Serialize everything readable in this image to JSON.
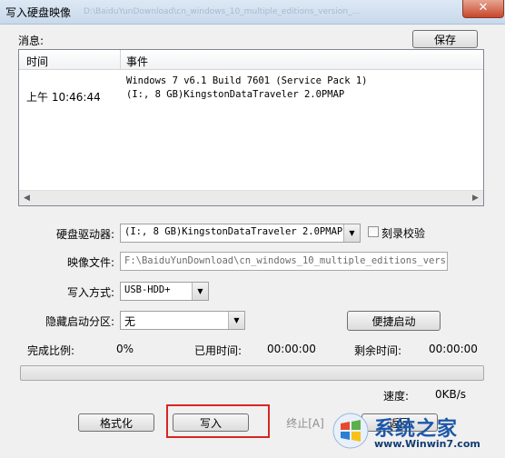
{
  "window": {
    "title": "写入硬盘映像",
    "title_path": "D:\\BaiduYunDownload\\cn_windows_10_multiple_editions_version_..."
  },
  "messages": {
    "label": "消息:",
    "save_label": "保存",
    "columns": [
      "时间",
      "事件"
    ],
    "rows": [
      {
        "time": "",
        "event": "Windows 7 v6.1 Build 7601 (Service Pack 1)"
      },
      {
        "time": "上午 10:46:44",
        "event": "(I:, 8 GB)KingstonDataTraveler 2.0PMAP"
      }
    ]
  },
  "form": {
    "drive_label": "硬盘驱动器:",
    "drive_value": "(I:, 8 GB)KingstonDataTraveler 2.0PMAP",
    "verify_label": "刻录校验",
    "verify_checked": false,
    "image_label": "映像文件:",
    "image_value": "F:\\BaiduYunDownload\\cn_windows_10_multiple_editions_version",
    "write_mode_label": "写入方式:",
    "write_mode_value": "USB-HDD+",
    "hidden_partition_label": "隐藏启动分区:",
    "hidden_partition_value": "无",
    "quick_boot_label": "便捷启动"
  },
  "status": {
    "complete_label": "完成比例:",
    "complete_value": "0%",
    "elapsed_label": "已用时间:",
    "elapsed_value": "00:00:00",
    "remaining_label": "剩余时间:",
    "remaining_value": "00:00:00",
    "progress": 0,
    "speed_label": "速度:",
    "speed_value": "0KB/s"
  },
  "buttons": {
    "format": "格式化",
    "write": "写入",
    "stop": "终止[A]",
    "back": "返回"
  },
  "watermark": {
    "title": "系统之家",
    "url": "www.Winwin7.com"
  },
  "colors": {
    "highlight": "#d82622",
    "brand_blue": "#1c57a8"
  }
}
